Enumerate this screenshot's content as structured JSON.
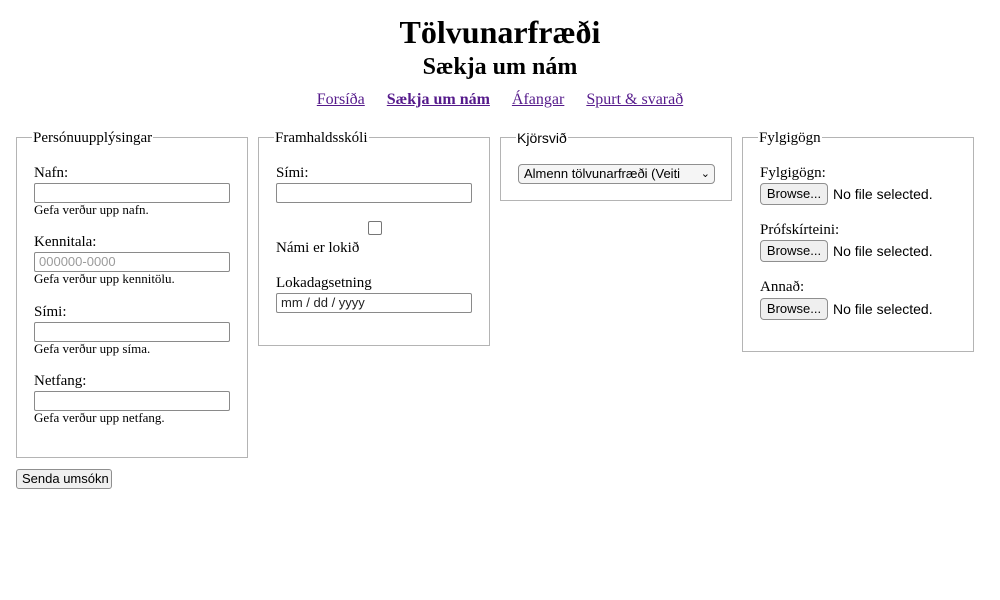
{
  "header": {
    "title": "Tölvunarfræði",
    "subtitle": "Sækja um nám"
  },
  "nav": {
    "items": [
      {
        "label": "Forsíða"
      },
      {
        "label": "Sækja um nám",
        "active": true
      },
      {
        "label": "Áfangar"
      },
      {
        "label": "Spurt & svarað"
      }
    ]
  },
  "personal": {
    "legend": "Persónuupplýsingar",
    "name_label": "Nafn:",
    "name_value": "",
    "name_hint": "Gefa verður upp nafn.",
    "kennitala_label": "Kennitala:",
    "kennitala_placeholder": "000000-0000",
    "kennitala_hint": "Gefa verður upp kennitölu.",
    "phone_label": "Sími:",
    "phone_value": "",
    "phone_hint": "Gefa verður upp síma.",
    "email_label": "Netfang:",
    "email_value": "",
    "email_hint": "Gefa verður upp netfang."
  },
  "school": {
    "legend": "Framhaldsskóli",
    "phone_label": "Sími:",
    "phone_value": "",
    "finished_label": "Námi er lokið",
    "finished_checked": false,
    "enddate_label": "Lokadagsetning",
    "enddate_placeholder": "mm / dd / yyyy"
  },
  "track": {
    "legend": "Kjörsvið",
    "selected": "Almenn tölvunarfræði (Veiti"
  },
  "attachments": {
    "legend": "Fylgigögn",
    "items": [
      {
        "label": "Fylgigögn:",
        "button": "Browse...",
        "status": "No file selected."
      },
      {
        "label": "Prófskírteini:",
        "button": "Browse...",
        "status": "No file selected."
      },
      {
        "label": "Annað:",
        "button": "Browse...",
        "status": "No file selected."
      }
    ]
  },
  "submit": {
    "label": "Senda umsókn"
  }
}
